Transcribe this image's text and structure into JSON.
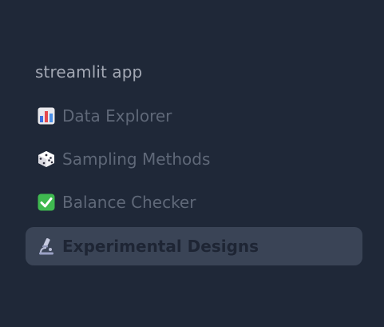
{
  "sidebar": {
    "app_title": "streamlit app",
    "items": [
      {
        "label": "Data Explorer",
        "icon": "bar-chart-icon",
        "active": false
      },
      {
        "label": "Sampling Methods",
        "icon": "dice-icon",
        "active": false
      },
      {
        "label": "Balance Checker",
        "icon": "check-mark-icon",
        "active": false
      },
      {
        "label": "Experimental Designs",
        "icon": "microscope-icon",
        "active": true
      }
    ]
  },
  "colors": {
    "background": "#1f2838",
    "active_item_bg": "#3a4456",
    "inactive_text": "#5f6878",
    "active_text": "#1e2534",
    "title_text": "#a3a8b4",
    "check_green": "#3fb950"
  }
}
